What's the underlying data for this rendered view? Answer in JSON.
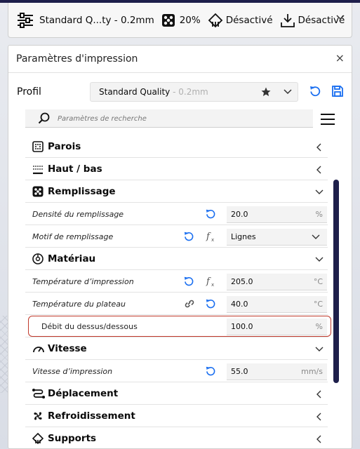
{
  "header": {
    "profile_summary": "Standard Q...ty - 0.2mm",
    "infill_percent": "20%",
    "support": "Désactivé",
    "adhesion": "Désactivé"
  },
  "panel": {
    "title": "Paramètres d'impression",
    "close": "×"
  },
  "profile": {
    "label": "Profil",
    "name": "Standard Quality",
    "variant": " - 0.2mm"
  },
  "search": {
    "placeholder": "Paramètres de recherche"
  },
  "sections": {
    "walls": "Parois",
    "topbottom": "Haut / bas",
    "infill": "Remplissage",
    "material": "Matériau",
    "speed": "Vitesse",
    "travel": "Déplacement",
    "cooling": "Refroidissement",
    "supports": "Supports"
  },
  "settings": {
    "infill_density": {
      "label": "Densité du remplissage",
      "value": "20.0",
      "unit": "%"
    },
    "infill_pattern": {
      "label": "Motif de remplissage",
      "value": "Lignes"
    },
    "print_temp": {
      "label": "Température d’impression",
      "value": "205.0",
      "unit": "°C"
    },
    "bed_temp": {
      "label": "Température du plateau",
      "value": "40.0",
      "unit": "°C"
    },
    "topbottom_flow": {
      "label": "Débit du dessus/dessous",
      "value": "100.0",
      "unit": "%"
    },
    "print_speed": {
      "label": "Vitesse d’impression",
      "value": "55.0",
      "unit": "mm/s"
    }
  },
  "colors": {
    "accent": "#196ef0",
    "highlight_border": "#c0392b",
    "scrollbar": "#1e1f4b"
  }
}
